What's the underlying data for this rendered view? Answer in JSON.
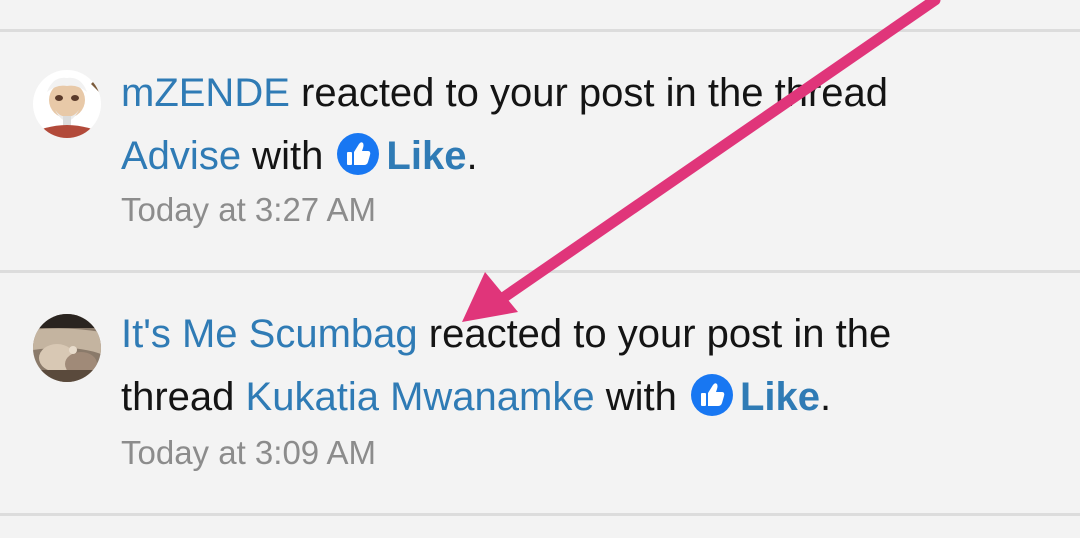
{
  "notifications": [
    {
      "user": "mZENDE",
      "action": " reacted to your post in the thread",
      "thread": "Advise",
      "with_text": " with ",
      "reaction": "Like",
      "period": ".",
      "time": "Today at 3:27 AM"
    },
    {
      "user": "It's Me Scumbag",
      "action": " reacted to your post in the",
      "thread_prefix": "thread ",
      "thread": "Kukatia Mwanamke",
      "with_text": " with ",
      "reaction": "Like",
      "period": ".",
      "time": "Today at 3:09 AM"
    }
  ],
  "colors": {
    "link": "#2f7bb5",
    "annotation_arrow": "#e0357a",
    "like_badge": "#1877f2"
  },
  "icons": {
    "reaction_icon": "thumbs-up-icon",
    "annotation": "arrow-annotation"
  }
}
